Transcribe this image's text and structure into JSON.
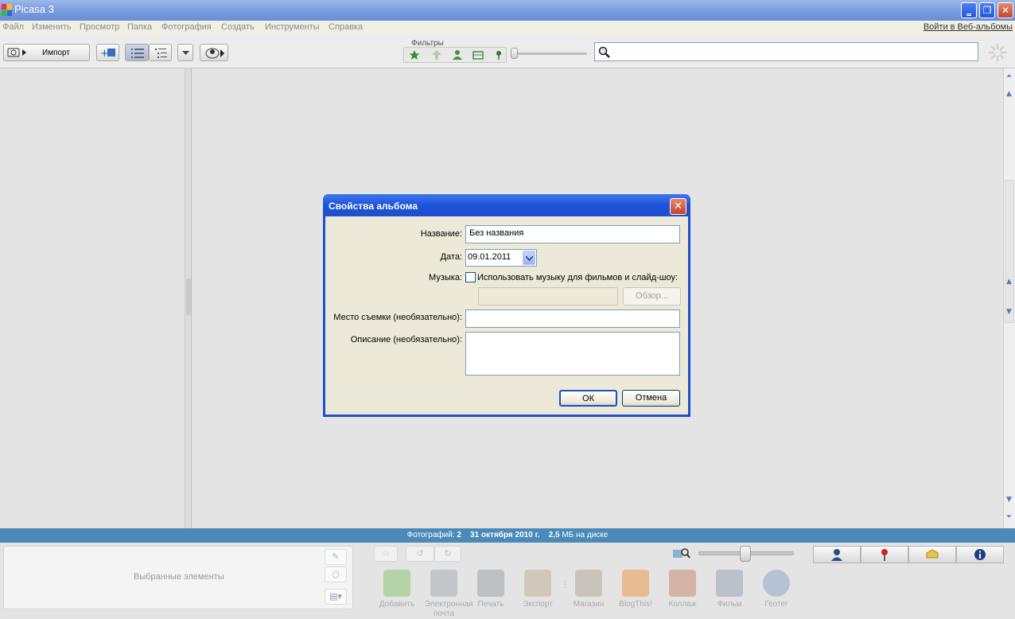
{
  "window": {
    "title": "Picasa 3",
    "min": "‗",
    "restore": "❐",
    "close": "✕"
  },
  "menu": [
    "Файл",
    "Изменить",
    "Просмотр",
    "Папка",
    "Фотография",
    "Создать",
    "Инструменты",
    "Справка"
  ],
  "web_signin": "Войти в Веб-альбомы",
  "toolbar": {
    "import_label": "Импорт",
    "filters_label": "Фильтры"
  },
  "status": {
    "photos_label": "Фотографий:",
    "photos_count": "2",
    "date": "31 октября 2010 г.",
    "size": "2,5",
    "size_unit": "МБ на диске"
  },
  "tray": {
    "label": "Выбранные элементы"
  },
  "actions": [
    {
      "label": "Добавить",
      "icon": "upload-icon",
      "color": "#7bbf5a"
    },
    {
      "label": "Электронная почта",
      "icon": "email-icon",
      "color": "#9aa0a8"
    },
    {
      "label": "Печать",
      "icon": "print-icon",
      "color": "#8f959c"
    },
    {
      "label": "Экспорт",
      "icon": "export-folder-icon",
      "color": "#b6a78a"
    },
    {
      "label": "Магазин",
      "icon": "shop-icon",
      "color": "#a89c8a"
    },
    {
      "label": "BlogThis!",
      "icon": "blogger-icon",
      "color": "#f08a2a"
    },
    {
      "label": "Коллаж",
      "icon": "collage-icon",
      "color": "#c07a5a"
    },
    {
      "label": "Фильм",
      "icon": "movie-icon",
      "color": "#8a96a8"
    },
    {
      "label": "Геотег",
      "icon": "earth-icon",
      "color": "#7a9ac0"
    }
  ],
  "dialog": {
    "title": "Свойства альбома",
    "name_label": "Название:",
    "name_value": "Без названия",
    "date_label": "Дата:",
    "date_value": "09.01.2011",
    "music_label": "Музыка:",
    "music_checkbox": "Использовать музыку для фильмов и слайд-шоу:",
    "browse": "Обзор...",
    "place_label": "Место съемки (необязательно):",
    "description_label": "Описание (необязательно):",
    "ok": "ОК",
    "cancel": "Отмена"
  }
}
